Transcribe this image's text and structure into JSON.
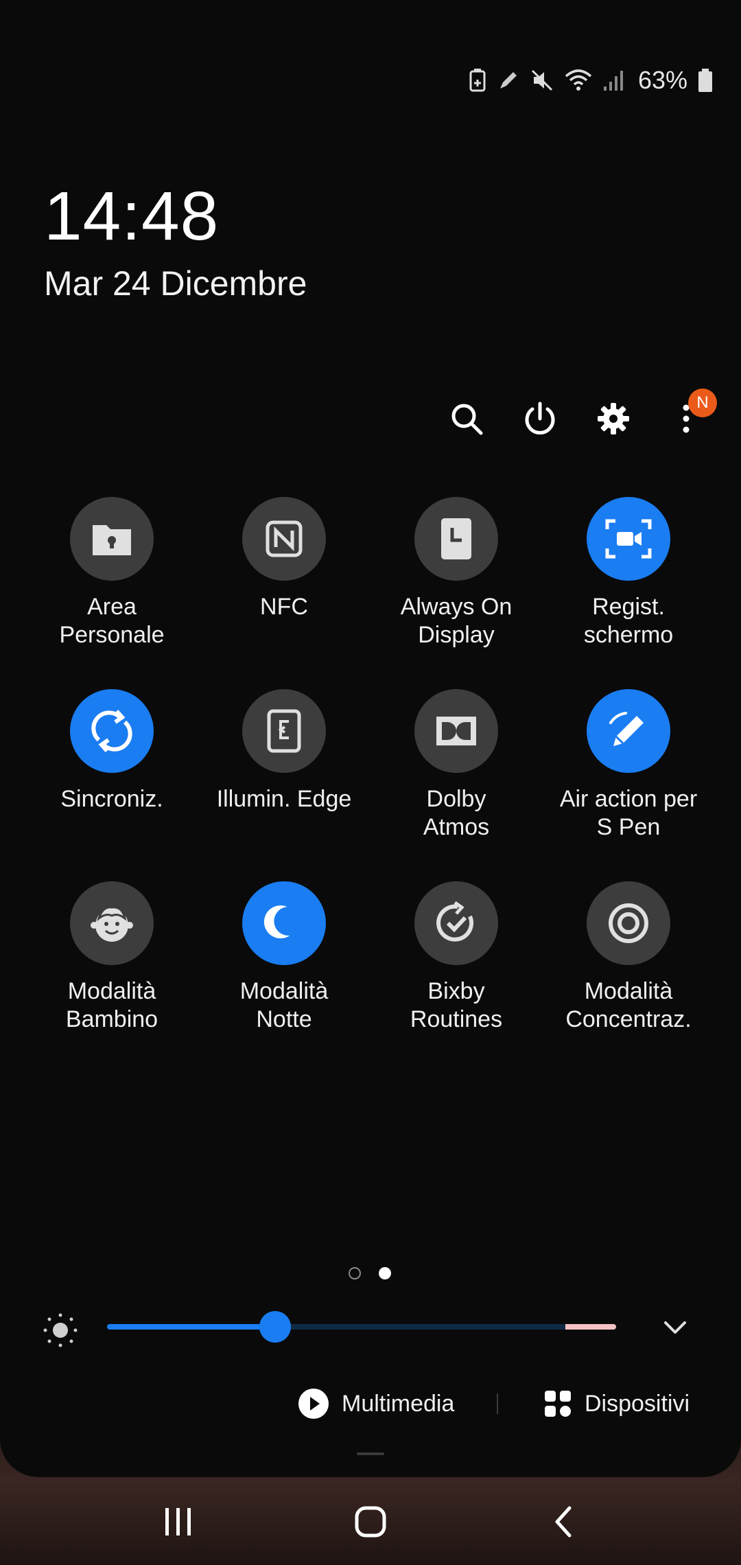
{
  "status_bar": {
    "battery_percent": "63%",
    "icons": [
      "battery-saver-icon",
      "pen-icon",
      "mute-icon",
      "wifi-icon",
      "signal-icon",
      "battery-icon"
    ]
  },
  "clock": {
    "time": "14:48",
    "date": "Mar 24 Dicembre"
  },
  "actions": {
    "icons": [
      "search-icon",
      "power-icon",
      "gear-icon",
      "more-icon"
    ],
    "notification_badge": "N"
  },
  "tiles": [
    {
      "label": "Area\nPersonale",
      "icon": "secure-folder-icon",
      "active": false
    },
    {
      "label": "NFC",
      "icon": "nfc-icon",
      "active": false
    },
    {
      "label": "Always On\nDisplay",
      "icon": "always-on-display-icon",
      "active": false
    },
    {
      "label": "Regist.\nschermo",
      "icon": "screen-record-icon",
      "active": true
    },
    {
      "label": "Sincroniz.",
      "icon": "sync-icon",
      "active": true
    },
    {
      "label": "Illumin. Edge",
      "icon": "edge-lighting-icon",
      "active": false
    },
    {
      "label": "Dolby\nAtmos",
      "icon": "dolby-icon",
      "active": false
    },
    {
      "label": "Air action per\nS Pen",
      "icon": "pen-icon",
      "active": true
    },
    {
      "label": "Modalità\nBambino",
      "icon": "kid-face-icon",
      "active": false
    },
    {
      "label": "Modalità\nNotte",
      "icon": "moon-icon",
      "active": true
    },
    {
      "label": "Bixby\nRoutines",
      "icon": "routine-check-icon",
      "active": false
    },
    {
      "label": "Modalità\nConcentraz.",
      "icon": "focus-target-icon",
      "active": false
    }
  ],
  "pagination": {
    "pages": 2,
    "current": 2
  },
  "brightness": {
    "level": 0.33,
    "icon": "sun-icon"
  },
  "bottom": {
    "media_label": "Multimedia",
    "devices_label": "Dispositivi"
  },
  "nav": [
    "recents-icon",
    "home-icon",
    "back-icon"
  ],
  "colors": {
    "accent": "#1a7df2",
    "tile_off": "#3d3d3d",
    "badge": "#ea5a19"
  }
}
